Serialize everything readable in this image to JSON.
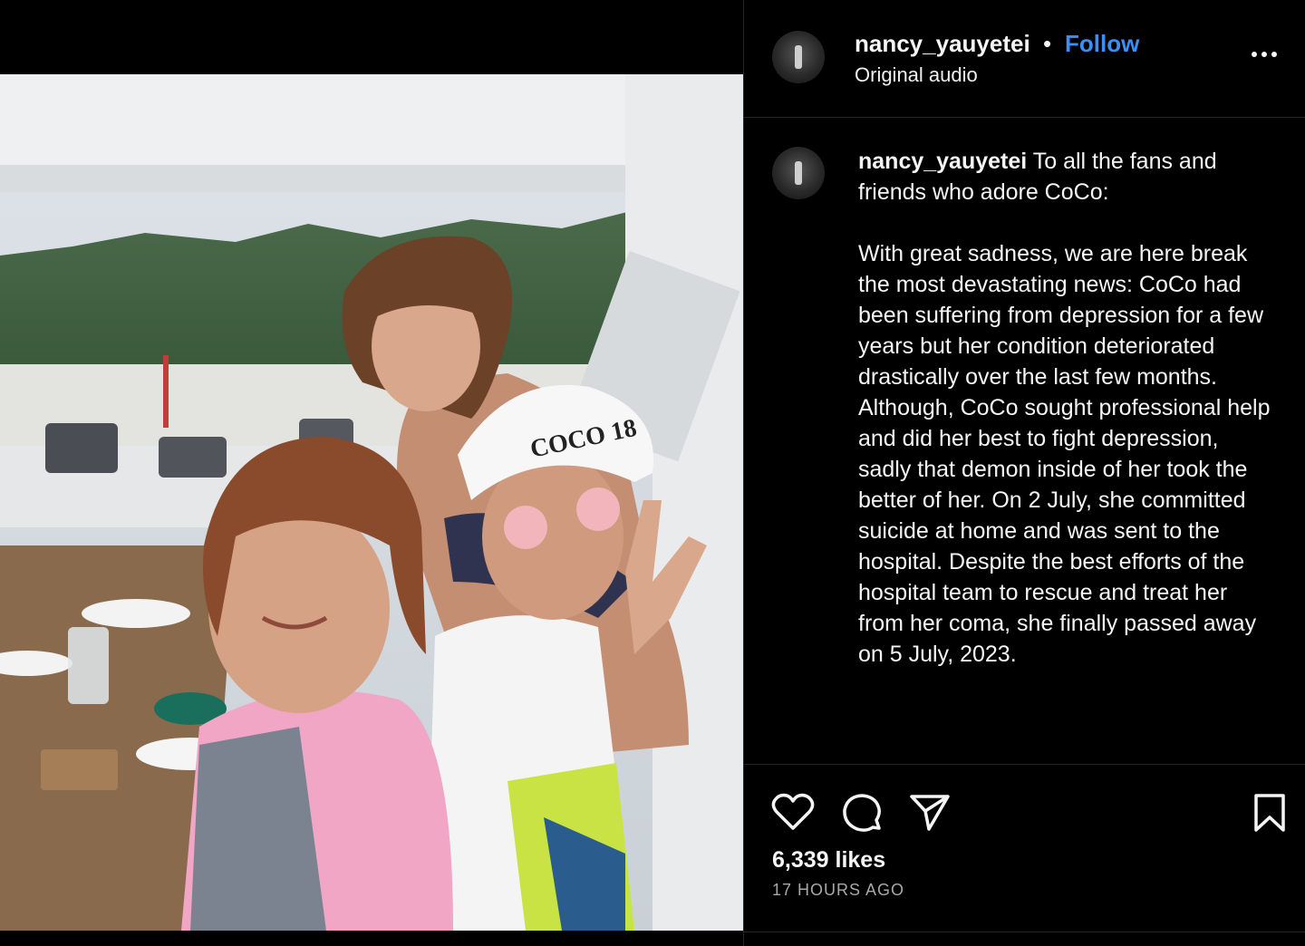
{
  "post": {
    "username": "nancy_yauyetei",
    "separator": "•",
    "follow_label": "Follow",
    "audio_label": "Original audio",
    "more_icon": "more-horizontal-icon"
  },
  "caption": {
    "username": "nancy_yauyetei",
    "intro": "To all the fans and friends who adore CoCo:",
    "body": "With great sadness, we are here break the most devastating news: CoCo had been suffering from depression for a few years but her condition deteriorated drastically over the last few months. Although, CoCo sought professional help and did her best to fight depression, sadly that demon inside of her took the better of her. On 2 July, she committed suicide at home and was sent to the hospital. Despite the best efforts of the hospital team to rescue and treat her from her coma, she finally passed away on 5 July, 2023."
  },
  "photo": {
    "cap_text": "COCO 18"
  },
  "actions": {
    "likes": "6,339 likes",
    "timestamp": "17 HOURS AGO",
    "icons": [
      "heart-icon",
      "comment-icon",
      "share-icon",
      "bookmark-icon"
    ]
  },
  "colors": {
    "background": "#000000",
    "accent": "#3b8ff5",
    "text": "#f5f5f5",
    "muted": "#a8a8a8",
    "divider": "#262626"
  }
}
